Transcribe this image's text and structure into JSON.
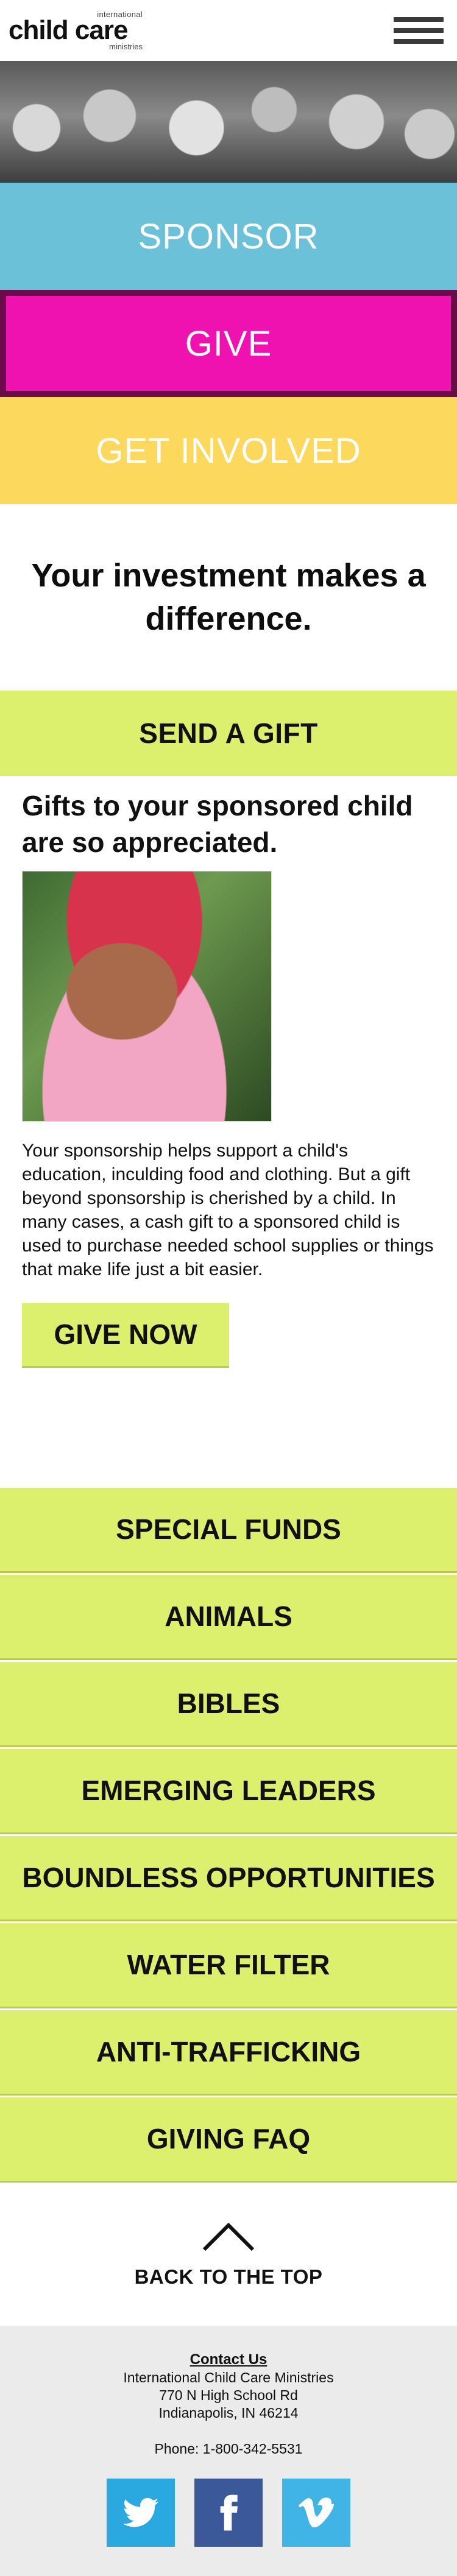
{
  "header": {
    "logo_top": "international",
    "logo_child": "child",
    "logo_care": "care",
    "logo_bottom": "ministries",
    "menu_icon": "hamburger-icon"
  },
  "nav_tiles": {
    "sponsor": "SPONSOR",
    "give": "GIVE",
    "get_involved": "GET INVOLVED"
  },
  "headline": "Your investment makes a difference.",
  "send_gift": {
    "bar_label": "SEND A GIFT",
    "title": "Gifts to your sponsored child are so appreciated.",
    "body": "Your sponsorship helps support a child's education, inculding food and clothing. But a gift beyond sponsorship is cherished by a child. In many cases, a cash gift to a sponsored child is used to purchase needed school supplies or things that make life just a bit easier.",
    "button_label": "GIVE NOW"
  },
  "funds": [
    "SPECIAL FUNDS",
    "ANIMALS",
    "BIBLES",
    "EMERGING LEADERS",
    "BOUNDLESS OPPORTUNITIES",
    "WATER FILTER",
    "ANTI-TRAFFICKING",
    "GIVING FAQ"
  ],
  "back_to_top": "BACK TO THE TOP",
  "footer": {
    "contact_label": "Contact Us",
    "org": "International Child Care Ministries",
    "street": "770 N High School Rd",
    "city": "Indianapolis, IN 46214",
    "phone": "Phone: 1-800-342-5531",
    "socials": [
      "twitter-icon",
      "facebook-icon",
      "vimeo-icon"
    ]
  },
  "colors": {
    "sponsor": "#6bc1d8",
    "give": "#f012b0",
    "give_border": "#6c0b4a",
    "get_involved": "#fcd85c",
    "lime": "#dcf06e",
    "footer_bg": "#ebebeb"
  }
}
